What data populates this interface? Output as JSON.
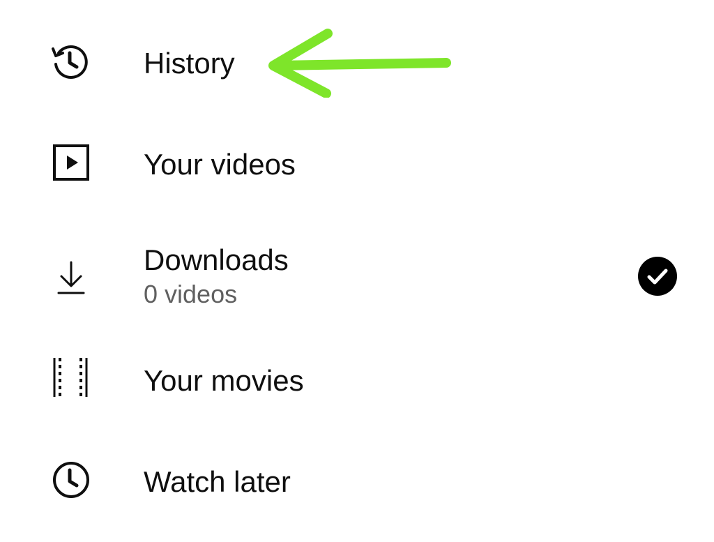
{
  "menu": {
    "items": [
      {
        "label": "History",
        "icon": "history-icon"
      },
      {
        "label": "Your videos",
        "icon": "play-box-icon"
      },
      {
        "label": "Downloads",
        "sublabel": "0 videos",
        "icon": "download-icon",
        "status_icon": "check-circle-icon"
      },
      {
        "label": "Your movies",
        "icon": "film-strip-icon"
      },
      {
        "label": "Watch later",
        "icon": "clock-icon"
      }
    ]
  },
  "annotation": {
    "icon": "arrow-left-icon",
    "color": "#7ee52a"
  },
  "colors": {
    "text_primary": "#0f0f0f",
    "text_secondary": "#606060",
    "badge": "#000000"
  }
}
